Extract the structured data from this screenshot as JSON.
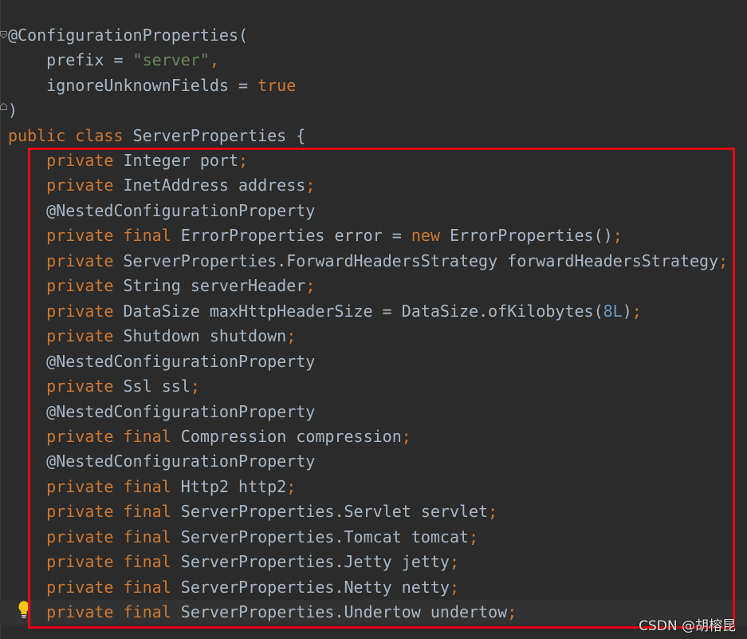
{
  "code": {
    "annotation_decl": {
      "name": "@ConfigurationProperties",
      "open": "(",
      "prefix_key": "prefix",
      "eq": " = ",
      "prefix_value": "\"server\"",
      "comma": ",",
      "ignore_key": "ignoreUnknownFields",
      "ignore_value": "true",
      "close": ")"
    },
    "class_decl": {
      "public_kw": "public",
      "class_kw": "class",
      "name": "ServerProperties",
      "brace": "{"
    },
    "fields": [
      {
        "text": "private Integer port;"
      },
      {
        "text": "private InetAddress address;"
      },
      {
        "text": "@NestedConfigurationProperty"
      },
      {
        "text": "private final ErrorProperties error = new ErrorProperties();"
      },
      {
        "text": "private ServerProperties.ForwardHeadersStrategy forwardHeadersStrategy;"
      },
      {
        "text": "private String serverHeader;"
      },
      {
        "text": "private DataSize maxHttpHeaderSize = DataSize.ofKilobytes(8L);"
      },
      {
        "text": "private Shutdown shutdown;"
      },
      {
        "text": "@NestedConfigurationProperty"
      },
      {
        "text": "private Ssl ssl;"
      },
      {
        "text": "@NestedConfigurationProperty"
      },
      {
        "text": "private final Compression compression;"
      },
      {
        "text": "@NestedConfigurationProperty"
      },
      {
        "text": "private final Http2 http2;"
      },
      {
        "text": "private final ServerProperties.Servlet servlet;"
      },
      {
        "text": "private final ServerProperties.Tomcat tomcat;"
      },
      {
        "text": "private final ServerProperties.Jetty jetty;"
      },
      {
        "text": "private final ServerProperties.Netty netty;"
      },
      {
        "text": "private final ServerProperties.Undertow undertow;"
      }
    ]
  },
  "icons": {
    "fold": "fold-icon",
    "bulb": "lightbulb-icon"
  },
  "colors": {
    "background": "#2b2b2b",
    "keyword": "#cc7832",
    "string": "#6a8759",
    "number": "#6897bb",
    "annotation": "#bbb529",
    "text": "#a9b7c6",
    "highlight_border": "#e60012"
  },
  "watermark": "CSDN @胡榕昆"
}
